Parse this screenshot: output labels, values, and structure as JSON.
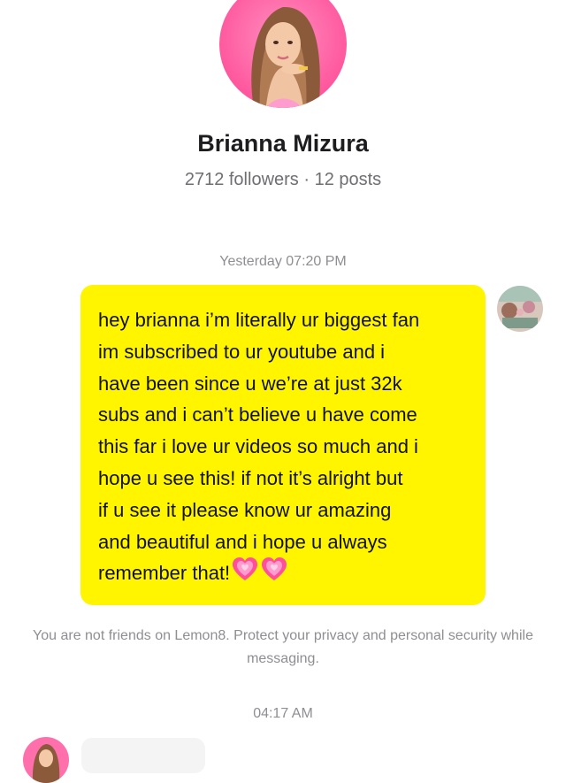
{
  "profile": {
    "name": "Brianna Mizura",
    "stats": "2712 followers · 12 posts",
    "avatar_icon": "profile-photo"
  },
  "conversation": {
    "timestamp_1": "Yesterday 07:20 PM",
    "outgoing_message": {
      "lines": [
        "hey brianna i’m literally ur biggest fan",
        "im subscribed to ur youtube and i",
        "have been since u we’re at just 32k",
        "subs and i can’t believe u have come",
        "this far i love ur videos so much and i",
        "hope u see this! if not it’s alright but",
        "if u see it please know ur amazing",
        "and beautiful and i hope u always",
        "remember that!"
      ],
      "emoji": "💗💗",
      "bubble_color": "#fff500"
    },
    "privacy_notice": "You are not friends on Lemon8. Protect your privacy and personal security while messaging.",
    "timestamp_2": "04:17 AM"
  },
  "colors": {
    "accent_pink": "#ff5fa2",
    "muted_text": "#8e8e93"
  }
}
